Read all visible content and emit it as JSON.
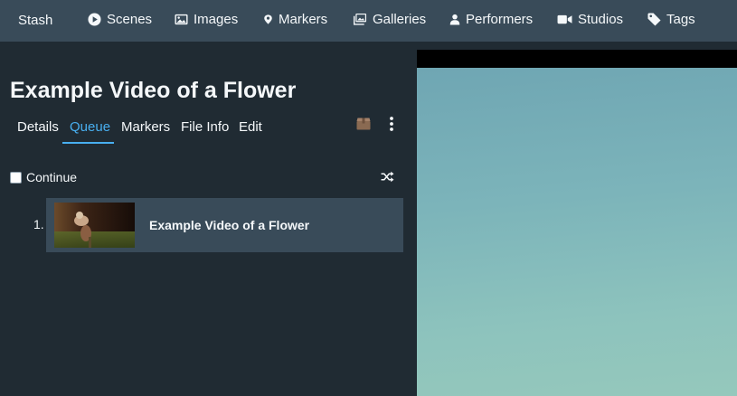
{
  "navbar": {
    "brand": "Stash",
    "items": [
      {
        "label": "Scenes",
        "icon": "play-circle-icon"
      },
      {
        "label": "Images",
        "icon": "image-icon"
      },
      {
        "label": "Markers",
        "icon": "map-marker-icon"
      },
      {
        "label": "Galleries",
        "icon": "images-icon"
      },
      {
        "label": "Performers",
        "icon": "user-icon"
      },
      {
        "label": "Studios",
        "icon": "video-camera-icon"
      },
      {
        "label": "Tags",
        "icon": "tag-icon"
      }
    ]
  },
  "scene": {
    "title": "Example Video of a Flower",
    "tabs": [
      {
        "label": "Details"
      },
      {
        "label": "Queue",
        "active": true
      },
      {
        "label": "Markers"
      },
      {
        "label": "File Info"
      },
      {
        "label": "Edit"
      }
    ],
    "toolbar_icons": [
      "box-icon",
      "kebab-menu-icon"
    ]
  },
  "queue": {
    "continue_label": "Continue",
    "continue_checked": false,
    "items": [
      {
        "number": "1.",
        "title": "Example Video of a Flower"
      }
    ]
  },
  "colors": {
    "navbar_bg": "#394b59",
    "page_bg": "#202b33",
    "accent": "#48aff0",
    "queue_item_bg": "#394b59"
  }
}
